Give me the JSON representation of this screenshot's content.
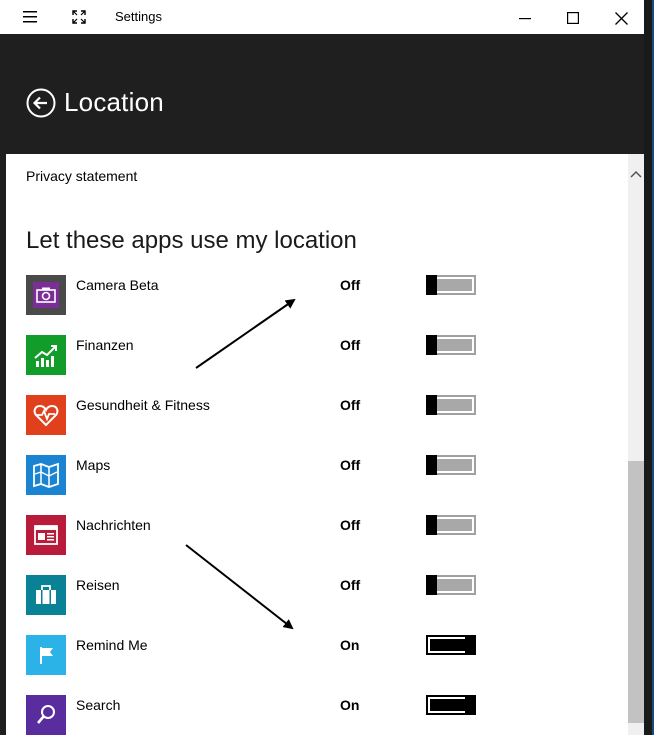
{
  "window": {
    "title": "Settings"
  },
  "header": {
    "title": "Location"
  },
  "content": {
    "privacy_link": "Privacy statement",
    "section_title": "Let these apps use my location",
    "apps": [
      {
        "name": "Camera Beta",
        "state": "Off",
        "icon": "camera-icon",
        "color": "#7a2e96"
      },
      {
        "name": "Finanzen",
        "state": "Off",
        "icon": "chart-icon",
        "color": "#129c2a"
      },
      {
        "name": "Gesundheit & Fitness",
        "state": "Off",
        "icon": "heart-pulse-icon",
        "color": "#e0401c"
      },
      {
        "name": "Maps",
        "state": "Off",
        "icon": "map-icon",
        "color": "#1b84d2"
      },
      {
        "name": "Nachrichten",
        "state": "Off",
        "icon": "newspaper-icon",
        "color": "#b81c3a"
      },
      {
        "name": "Reisen",
        "state": "Off",
        "icon": "suitcase-icon",
        "color": "#0a8296"
      },
      {
        "name": "Remind Me",
        "state": "On",
        "icon": "flag-icon",
        "color": "#2bb3e8"
      },
      {
        "name": "Search",
        "state": "On",
        "icon": "search-icon",
        "color": "#5a2d9e"
      }
    ]
  }
}
